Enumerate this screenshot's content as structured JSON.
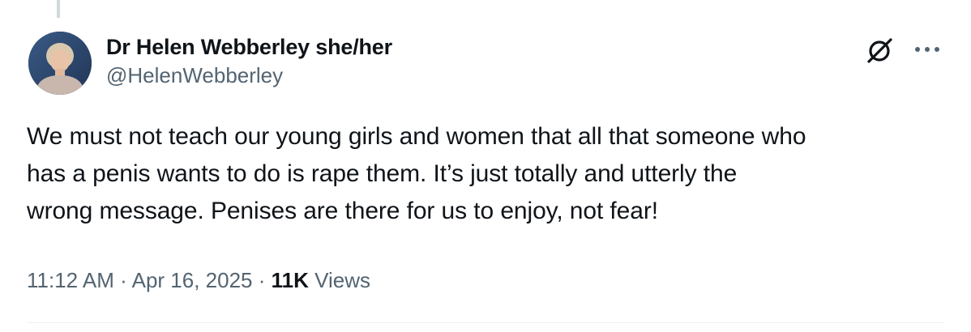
{
  "author": {
    "display_name": "Dr Helen Webberley she/her",
    "handle": "@HelenWebberley"
  },
  "tweet": {
    "text": "We must not teach our young girls and women that all that someone who\nhas a penis wants to do is rape them. It’s just totally and utterly the\nwrong message. Penises are there for us to enjoy, not fear!"
  },
  "meta": {
    "time": "11:12 AM",
    "separator": " · ",
    "date": "Apr 16, 2025",
    "views_count": "11K",
    "views_label": " Views"
  },
  "icons": {
    "grok": "grok-icon",
    "more": "more-icon",
    "avatar": "avatar"
  },
  "colors": {
    "text_primary": "#0f1419",
    "text_secondary": "#536471",
    "divider": "#eff3f4",
    "thread_line": "#cfd9de"
  }
}
